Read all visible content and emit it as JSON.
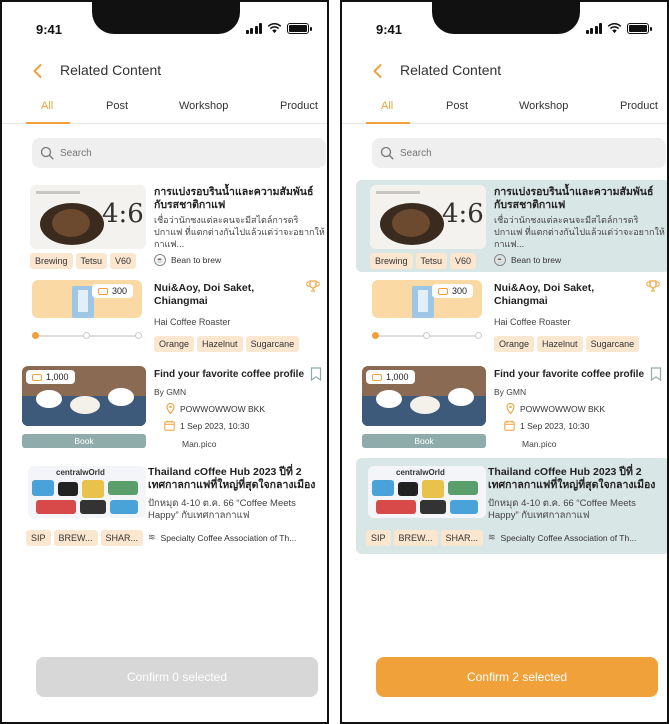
{
  "status": {
    "time": "9:41"
  },
  "header": {
    "title": "Related Content"
  },
  "tabs": [
    {
      "label": "All"
    },
    {
      "label": "Post"
    },
    {
      "label": "Workshop"
    },
    {
      "label": "Product"
    }
  ],
  "search": {
    "placeholder": "Search"
  },
  "items": {
    "post": {
      "title": "การแบ่งรอบรินน้ำและความสัมพันธ์กับรสชาติกาแฟ",
      "description": "เชื่อว่านักชงแต่ละคนจะมีสไตล์การดริปกาแฟ ที่แตกต่างกันไปแล้วแต่ว่าจะอยากให้กาแฟ...",
      "author": "Bean to brew",
      "tags": [
        "Brewing",
        "Tetsu",
        "V60"
      ],
      "thumb_text": "4:6"
    },
    "product": {
      "title": "Nui&Aoy, Doi Saket, Chiangmai",
      "seller": "Hai Coffee Roaster",
      "price": "300",
      "tags": [
        "Orange",
        "Hazelnut",
        "Sugarcane"
      ],
      "rating_level": 0
    },
    "workshop": {
      "title": "Find your favorite coffee profile",
      "host": "By GMN",
      "location": "POWWOWWOW BKK",
      "datetime": "1 Sep 2023, 10:30",
      "organizer": "Man.pico",
      "price": "1,000",
      "book_label": "Book"
    },
    "event": {
      "title": "Thailand cOffee Hub 2023 ปีที่ 2 เทศกาลกาแฟที่ใหญ่ที่สุดใจกลางเมือง",
      "description": "ปักหมุด 4-10 ต.ค. 66 “Coffee Meets Happy” กับเทศกาลกาแฟ",
      "association": "Specialty Coffee Association of Th...",
      "tags": [
        "SIP",
        "BREW...",
        "SHAR..."
      ],
      "thumb_brand": "centralwOrld"
    }
  },
  "screens": [
    {
      "confirm_label": "Confirm 0 selected",
      "confirm_enabled": false,
      "selected": []
    },
    {
      "confirm_label": "Confirm 2 selected",
      "confirm_enabled": true,
      "selected": [
        "post",
        "event"
      ]
    }
  ],
  "colors": {
    "accent": "#f0a13a",
    "selected_bg": "#d9e6e6",
    "chip_bg": "#fbe6cf",
    "book_btn": "#8fabaa",
    "disabled_btn": "#d7d7d7"
  }
}
